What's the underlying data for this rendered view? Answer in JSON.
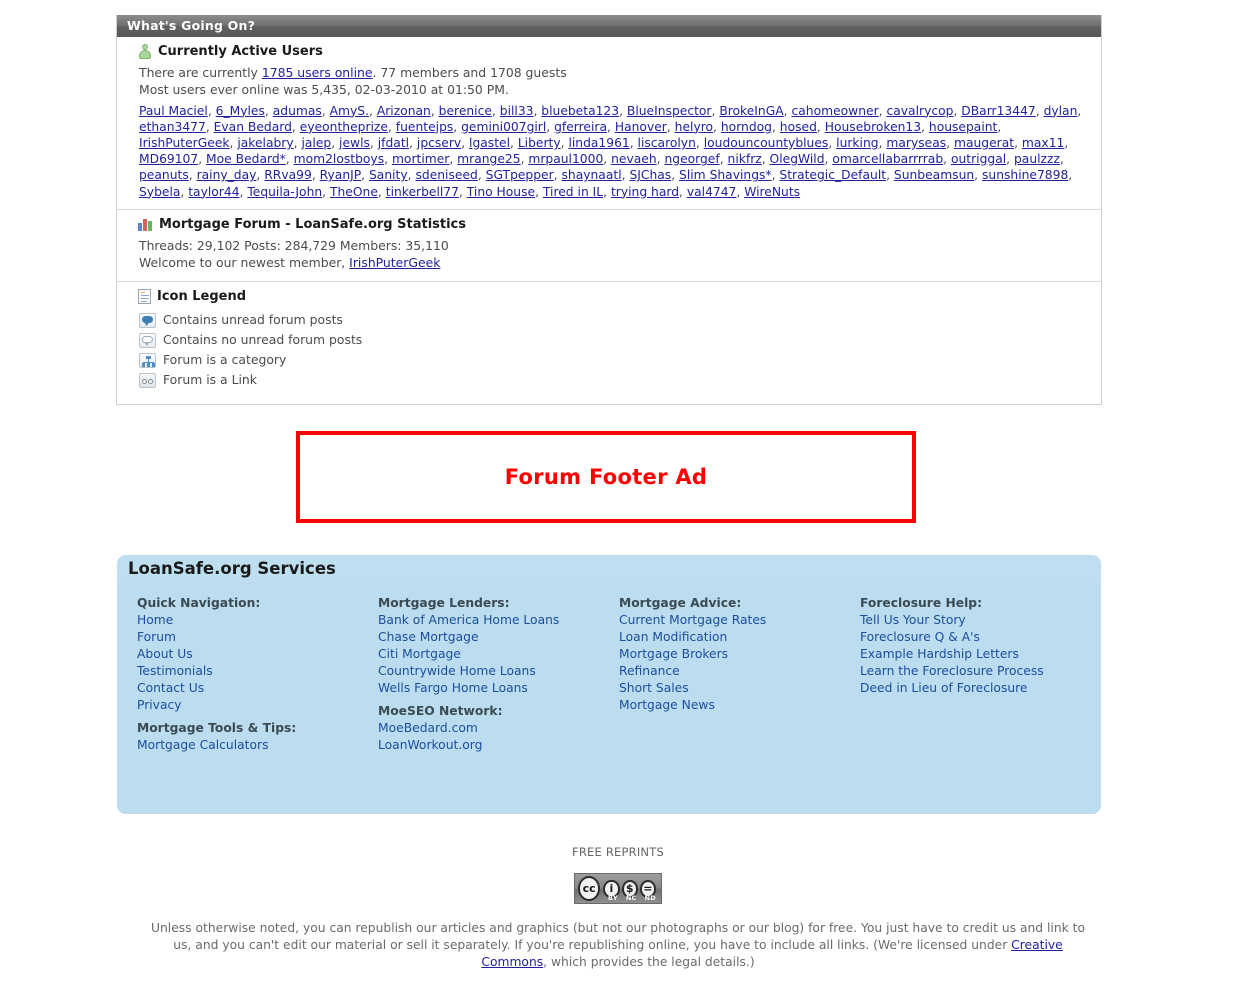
{
  "whats_going_on": {
    "header_title": "What's Going On?",
    "active_users": {
      "title": "Currently Active Users",
      "icon": "user-icon",
      "line1_prefix": "There are currently ",
      "line1_link": "1785 users online",
      "line1_suffix": ". 77 members and 1708 guests",
      "line2": "Most users ever online was 5,435, 02-03-2010 at 01:50 PM.",
      "users": [
        "Paul Maciel",
        "6_Myles",
        "adumas",
        "AmyS.",
        "Arizonan",
        "berenice",
        "bill33",
        "bluebeta123",
        "BlueInspector",
        "BrokeInGA",
        "cahomeowner",
        "cavalrycop",
        "DBarr13447",
        "dylan",
        "ethan3477",
        "Evan Bedard",
        "eyeontheprize",
        "fuentejps",
        "gemini007girl",
        "gferreira",
        "Hanover",
        "helyro",
        "horndog",
        "hosed",
        "Housebroken13",
        "housepaint",
        "IrishPuterGeek",
        "jakelabry",
        "jalep",
        "jewls",
        "jfdatl",
        "jpcserv",
        "lgastel",
        "Liberty",
        "linda1961",
        "liscarolyn",
        "loudouncountyblues",
        "lurking",
        "maryseas",
        "maugerat",
        "max11",
        "MD69107",
        "Moe Bedard*",
        "mom2lostboys",
        "mortimer",
        "mrange25",
        "mrpaul1000",
        "nevaeh",
        "ngeorgef",
        "nikfrz",
        "OlegWild",
        "omarcellabarrrrab",
        "outriggal",
        "paulzzz",
        "peanuts",
        "rainy_day",
        "RRva99",
        "RyanJP",
        "Sanity",
        "sdeniseed",
        "SGTpepper",
        "shaynaatl",
        "SJChas",
        "Slim Shavings*",
        "Strategic_Default",
        "Sunbeamsun",
        "sunshine7898",
        "Sybela",
        "taylor44",
        "Tequila-John",
        "TheOne",
        "tinkerbell77",
        "Tino House",
        "Tired in IL",
        "trying hard",
        "val4747",
        "WireNuts"
      ]
    },
    "statistics": {
      "title": "Mortgage Forum - LoanSafe.org Statistics",
      "icon": "bar-chart-icon",
      "counts_line": "Threads: 29,102  Posts: 284,729  Members: 35,110",
      "welcome_prefix": "Welcome to our newest member, ",
      "newest_member": "IrishPuterGeek"
    },
    "icon_legend": {
      "title": "Icon Legend",
      "icon": "document-icon",
      "items": [
        {
          "icon": "unread-posts-icon",
          "label": "Contains unread forum posts"
        },
        {
          "icon": "read-posts-icon",
          "label": "Contains no unread forum posts"
        },
        {
          "icon": "category-icon",
          "label": "Forum is a category"
        },
        {
          "icon": "link-icon",
          "label": "Forum is a Link"
        }
      ]
    }
  },
  "footer_ad": {
    "label": "Forum Footer Ad",
    "border_color": "#fe0000",
    "text_color": "#fe0000"
  },
  "services": {
    "header_title": "LoanSafe.org Services",
    "panel_color": "#bddff0",
    "columns": [
      {
        "groups": [
          {
            "heading": "Quick Navigation:",
            "links": [
              "Home",
              "Forum",
              "About Us",
              "Testimonials",
              "Contact Us",
              "Privacy"
            ]
          },
          {
            "heading": "Mortgage Tools & Tips:",
            "links": [
              "Mortgage Calculators"
            ]
          }
        ]
      },
      {
        "groups": [
          {
            "heading": "Mortgage Lenders:",
            "links": [
              "Bank of America Home Loans",
              "Chase Mortgage",
              "Citi Mortgage",
              "Countrywide Home Loans",
              "Wells Fargo Home Loans"
            ]
          },
          {
            "heading": "MoeSEO Network:",
            "links": [
              "MoeBedard.com",
              "LoanWorkout.org"
            ]
          }
        ]
      },
      {
        "groups": [
          {
            "heading": "Mortgage Advice:",
            "links": [
              "Current Mortgage Rates",
              "Loan Modification",
              "Mortgage Brokers",
              "Refinance",
              "Short Sales",
              "Mortgage News"
            ]
          }
        ]
      },
      {
        "groups": [
          {
            "heading": "Foreclosure Help:",
            "links": [
              "Tell Us Your Story",
              "Foreclosure Q & A's",
              "Example Hardship Letters",
              "Learn the Foreclosure Process",
              "Deed in Lieu of Foreclosure"
            ]
          }
        ]
      }
    ]
  },
  "reprints": {
    "title": "FREE REPRINTS",
    "cc_badge": {
      "icon": "creative-commons-badge",
      "main": "cc",
      "marks": [
        {
          "glyph": "i",
          "label": "BY"
        },
        {
          "glyph": "$",
          "label": "NC"
        },
        {
          "glyph": "=",
          "label": "ND"
        }
      ]
    },
    "text_before": "Unless otherwise noted, you can republish our articles and graphics (but not our photographs or our blog) for free. You just have to credit us and link to us, and you can't edit our material or sell it separately. If you're republishing online, you have to include all links. (We're licensed under ",
    "link": "Creative Commons",
    "text_after": ", which provides the legal details.)"
  }
}
